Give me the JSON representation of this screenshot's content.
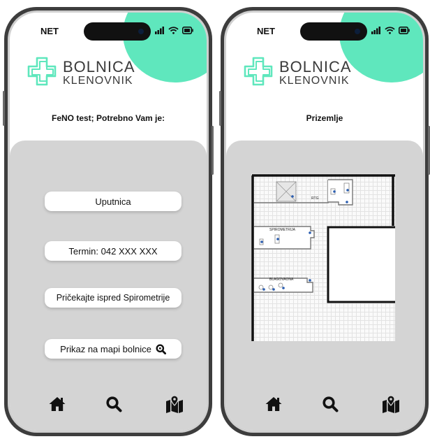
{
  "status_bar": {
    "carrier": "NET"
  },
  "brand": {
    "line1": "BOLNICA",
    "line2": "KLENOVNIK",
    "accent_color": "#5fe7bd"
  },
  "left_screen": {
    "heading": "FeNO test; Potrebno Vam je:",
    "buttons": [
      {
        "label": "Uputnica"
      },
      {
        "label": "Termin: 042 XXX XXX"
      },
      {
        "label": "Pričekajte ispred Spirometrije"
      },
      {
        "label": "Prikaz na mapi bolnice",
        "icon": "search-icon"
      }
    ]
  },
  "right_screen": {
    "heading": "Prizemlje",
    "map_labels": {
      "rtg": "RTG",
      "spirometrija": "SPIROMETRIJA",
      "blagovaona": "BLAGOVAONA"
    }
  },
  "bottom_nav": [
    {
      "icon": "home-icon"
    },
    {
      "icon": "search-icon"
    },
    {
      "icon": "map-location-icon"
    }
  ]
}
